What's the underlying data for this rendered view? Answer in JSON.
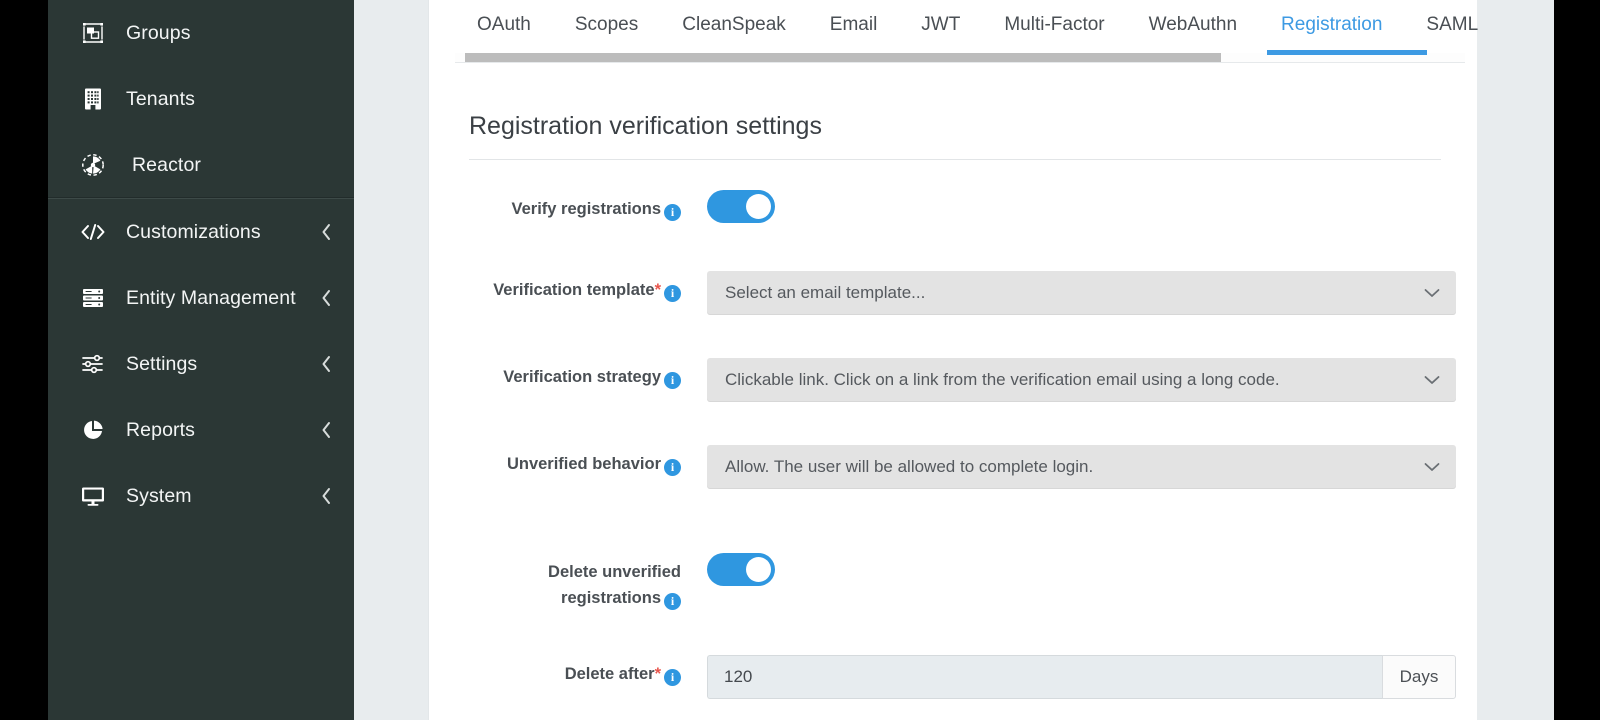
{
  "theme": {
    "accent": "#3d9ae3",
    "toggle_on": "#2f97e0",
    "info_blue": "#2f97e0",
    "required_red": "#e8554c",
    "sidebar_bg": "#2b3735"
  },
  "sidebar": {
    "groups": [
      {
        "items": [
          {
            "label": "Groups",
            "icon": "groups-icon",
            "expandable": false
          },
          {
            "label": "Tenants",
            "icon": "tenants-icon",
            "expandable": false
          },
          {
            "label": "Reactor",
            "icon": "reactor-icon",
            "expandable": false
          }
        ]
      },
      {
        "items": [
          {
            "label": "Customizations",
            "icon": "code-icon",
            "expandable": true,
            "chevron": "chevron-left-icon"
          },
          {
            "label": "Entity Management",
            "icon": "database-icon",
            "expandable": true,
            "chevron": "chevron-left-icon"
          },
          {
            "label": "Settings",
            "icon": "sliders-icon",
            "expandable": true,
            "chevron": "chevron-left-icon"
          },
          {
            "label": "Reports",
            "icon": "piechart-icon",
            "expandable": true,
            "chevron": "chevron-left-icon"
          },
          {
            "label": "System",
            "icon": "monitor-icon",
            "expandable": true,
            "chevron": "chevron-left-icon"
          }
        ]
      }
    ]
  },
  "tabs": [
    {
      "label": "OAuth",
      "active": false
    },
    {
      "label": "Scopes",
      "active": false
    },
    {
      "label": "CleanSpeak",
      "active": false
    },
    {
      "label": "Email",
      "active": false
    },
    {
      "label": "JWT",
      "active": false
    },
    {
      "label": "Multi-Factor",
      "active": false
    },
    {
      "label": "WebAuthn",
      "active": false
    },
    {
      "label": "Registration",
      "active": true
    },
    {
      "label": "SAML",
      "active": false
    }
  ],
  "main": {
    "section_title": "Registration verification settings",
    "fields": {
      "verify_registrations": {
        "label": "Verify registrations",
        "info": "i",
        "toggle_state": "on"
      },
      "verification_template": {
        "label": "Verification template",
        "required_marker": "*",
        "info": "i",
        "value": "Select an email template...",
        "chevron": "chevron-down-icon"
      },
      "verification_strategy": {
        "label": "Verification strategy",
        "info": "i",
        "value": "Clickable link. Click on a link from the verification email using a long code.",
        "chevron": "chevron-down-icon"
      },
      "unverified_behavior": {
        "label": "Unverified behavior",
        "info": "i",
        "value": "Allow. The user will be allowed to complete login.",
        "chevron": "chevron-down-icon"
      },
      "delete_unverified_registrations": {
        "label": "Delete unverified registrations",
        "info": "i",
        "toggle_state": "on"
      },
      "delete_after": {
        "label": "Delete after",
        "required_marker": "*",
        "info": "i",
        "value": "120",
        "unit": "Days"
      }
    }
  }
}
